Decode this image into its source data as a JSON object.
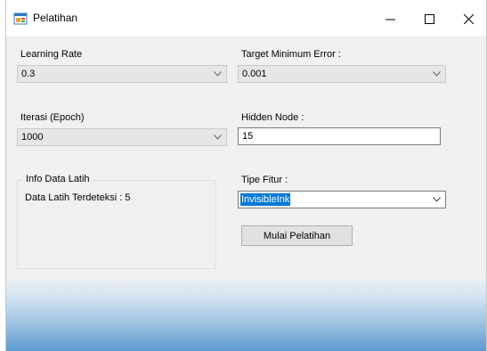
{
  "window": {
    "title": "Pelatihan"
  },
  "controls": {
    "minimize": "–",
    "maximize": "☐",
    "close": "X"
  },
  "fields": {
    "learning_rate": {
      "label": "Learning Rate",
      "value": "0.3"
    },
    "target_error": {
      "label": "Target Minimum Error :",
      "value": "0.001"
    },
    "iterasi": {
      "label": "Iterasi (Epoch)",
      "value": "1000"
    },
    "hidden_node": {
      "label": "Hidden Node :",
      "value": "15"
    },
    "tipe_fitur": {
      "label": "Tipe Fitur :",
      "value": "InvisibleInk"
    }
  },
  "info": {
    "title": "Info Data Latih",
    "text": "Data Latih Terdeteksi : 5"
  },
  "button": {
    "label": "Mulai Pelatihan"
  },
  "icons": {
    "app": "app-window-icon",
    "dropdown": "chevron-down-icon"
  },
  "colors": {
    "selection": "#0078d7",
    "footer": "#5d9bd1"
  }
}
